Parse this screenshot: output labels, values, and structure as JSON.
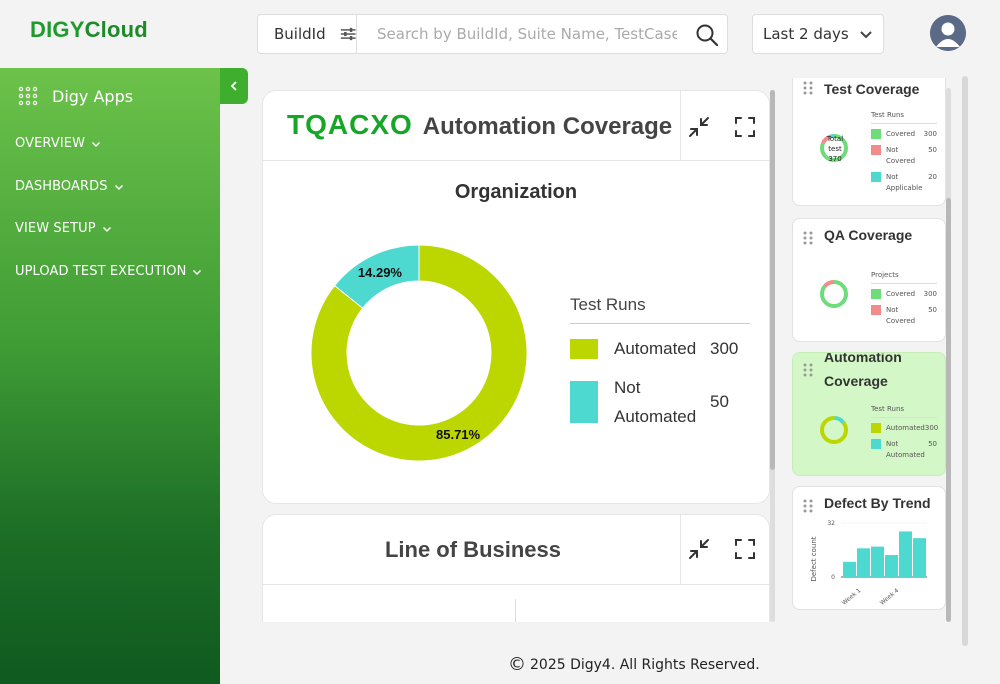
{
  "header": {
    "logo_part1": "DIGY",
    "logo_part2": "Cloud",
    "filter_label": "BuildId",
    "search_placeholder": "Search by BuildId, Suite Name, TestCase Na",
    "date_range": "Last 2 days"
  },
  "sidebar": {
    "apps_label": "Digy Apps",
    "items": [
      {
        "label": "OVERVIEW"
      },
      {
        "label": "DASHBOARDS"
      },
      {
        "label": "VIEW SETUP"
      },
      {
        "label": "UPLOAD TEST EXECUTION"
      }
    ]
  },
  "main": {
    "panel1": {
      "brand": "TQACXO",
      "title": "Automation Coverage",
      "subtitle": "Organization",
      "legend_title": "Test Runs",
      "series": [
        {
          "label": "Automated",
          "value": 300,
          "percent_label": "85.71%",
          "color": "#bcd600"
        },
        {
          "label": "Not Automated",
          "value": 50,
          "percent_label": "14.29%",
          "color": "#4dd8d0"
        }
      ]
    },
    "panel2": {
      "title": "Line of Business"
    }
  },
  "widgets": [
    {
      "title": "Test Coverage",
      "legend_title": "Test Runs",
      "center_label": "Total test 370",
      "items": [
        {
          "label": "Covered",
          "value": "300",
          "color": "#6fdc7c"
        },
        {
          "label": "Not Covered",
          "value": "50",
          "color": "#f28b8b"
        },
        {
          "label": "Not Applicable",
          "value": "20",
          "color": "#4dd8d0"
        }
      ]
    },
    {
      "title": "QA Coverage",
      "legend_title": "Projects",
      "items": [
        {
          "label": "Covered",
          "value": "300",
          "color": "#6fdc7c"
        },
        {
          "label": "Not Covered",
          "value": "50",
          "color": "#f28b8b"
        }
      ]
    },
    {
      "title": "Automation Coverage",
      "legend_title": "Test Runs",
      "items": [
        {
          "label": "Automated",
          "value": "300",
          "color": "#bcd600"
        },
        {
          "label": "Not Automated",
          "value": "50",
          "color": "#4dd8d0"
        }
      ]
    },
    {
      "title": "Defect By Trend",
      "chart_data": {
        "type": "bar",
        "ylabel": "Defect count",
        "y_ticks": [
          "32",
          "0"
        ],
        "x_ticks": [
          "Week 1",
          "Week 4"
        ],
        "ylim": [
          0,
          32
        ],
        "values": [
          9,
          17,
          18,
          13,
          27,
          23
        ]
      }
    }
  ],
  "footer": {
    "copyright_symbol": "©",
    "text": "2025 Digy4. All Rights Reserved."
  }
}
